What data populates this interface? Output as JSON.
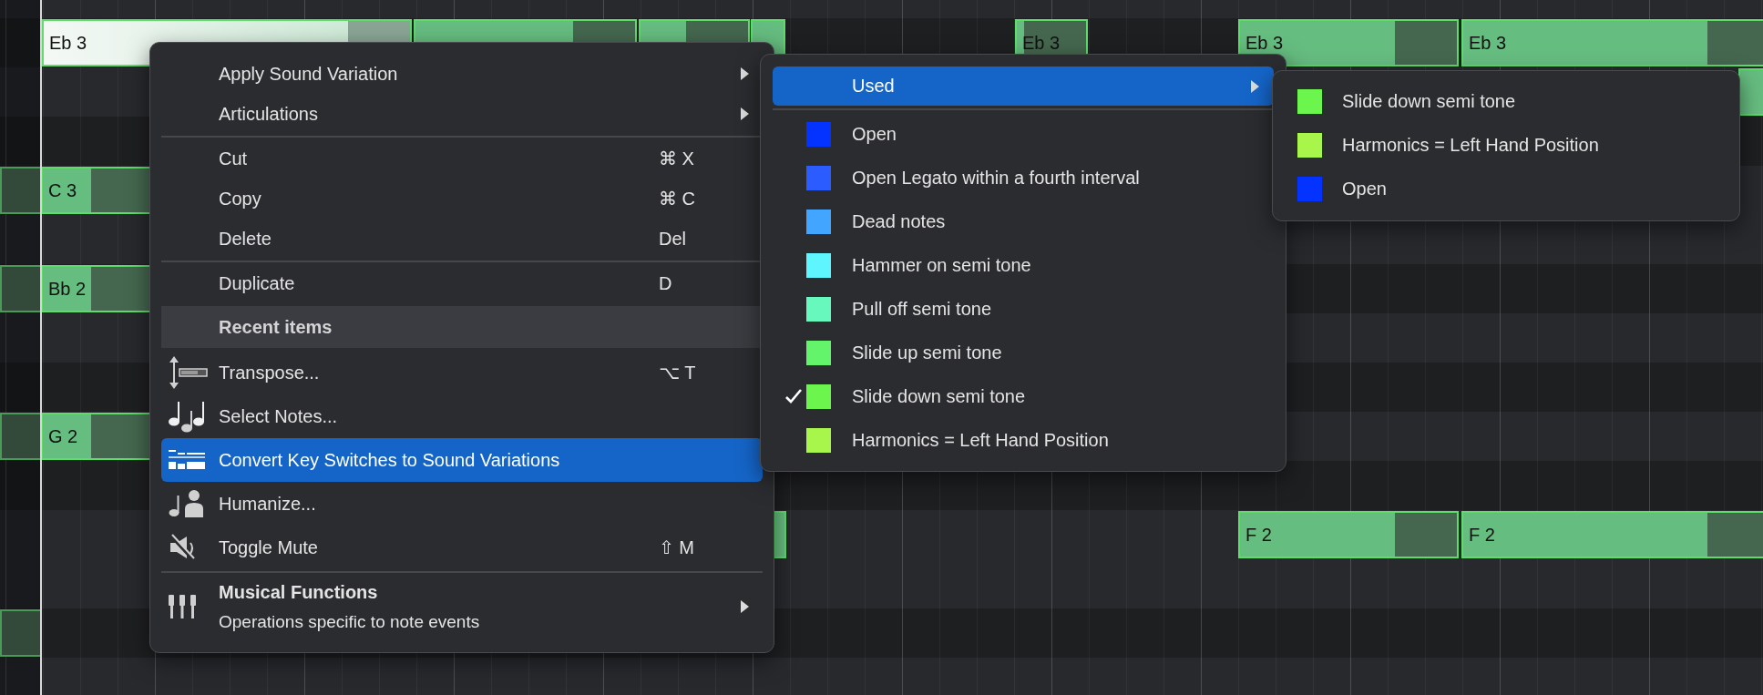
{
  "piano_roll": {
    "notes": [
      {
        "label": "Eb 3",
        "selected": true
      },
      {
        "selected": false
      },
      {
        "selected": false
      },
      {
        "selected": false
      },
      {
        "label": "Eb 3",
        "selected": false
      },
      {
        "label": "Eb 3",
        "selected": false
      },
      {
        "label": "Eb 3",
        "selected": false
      },
      {
        "selected": false
      },
      {
        "selected": false
      },
      {
        "label": "C 3",
        "selected": false
      },
      {
        "selected": false
      },
      {
        "label": "Bb 2",
        "selected": false
      },
      {
        "selected": false
      },
      {
        "label": "G 2",
        "selected": false
      },
      {
        "selected": false
      },
      {
        "label": "F 2",
        "selected": false
      },
      {
        "label": "F 2",
        "selected": false
      },
      {
        "selected": false
      }
    ]
  },
  "context_menu": {
    "sections": [
      {
        "items": [
          {
            "kind": "item",
            "label": "Apply Sound Variation",
            "submenu": true,
            "selected": false
          },
          {
            "kind": "item",
            "label": "Articulations",
            "submenu": true,
            "selected": false
          }
        ]
      },
      {
        "items": [
          {
            "kind": "item",
            "label": "Cut",
            "shortcut": "⌘ X",
            "selected": false
          },
          {
            "kind": "item",
            "label": "Copy",
            "shortcut": "⌘ C",
            "selected": false
          },
          {
            "kind": "item",
            "label": "Delete",
            "shortcut": "Del",
            "selected": false
          }
        ]
      },
      {
        "items": [
          {
            "kind": "item",
            "label": "Duplicate",
            "shortcut": "D",
            "selected": false
          },
          {
            "kind": "header",
            "label": "Recent items"
          },
          {
            "kind": "item",
            "label": "Transpose...",
            "shortcut": "⌥ T",
            "selected": false
          },
          {
            "kind": "item",
            "label": "Select Notes...",
            "selected": false
          },
          {
            "kind": "item",
            "label": "Convert Key Switches to Sound Variations",
            "selected": true
          },
          {
            "kind": "item",
            "label": "Humanize...",
            "selected": false
          },
          {
            "kind": "item",
            "label": "Toggle Mute",
            "shortcut": "⇧ M",
            "selected": false
          }
        ]
      },
      {
        "items": [
          {
            "kind": "group",
            "label": "Musical Functions",
            "description": "Operations specific to note events",
            "submenu": true,
            "selected": false
          }
        ]
      }
    ]
  },
  "sound_variation_menu": {
    "header": {
      "label": "Used",
      "submenu": true,
      "selected": true
    },
    "items": [
      {
        "label": "Open",
        "color": "#0433ff",
        "checked": false
      },
      {
        "label": "Open Legato within a fourth interval",
        "color": "#2a5cff",
        "checked": false
      },
      {
        "label": "Dead notes",
        "color": "#42a5ff",
        "checked": false
      },
      {
        "label": "Hammer on semi tone",
        "color": "#5ff5ff",
        "checked": false
      },
      {
        "label": "Pull off semi tone",
        "color": "#66f8bc",
        "checked": false
      },
      {
        "label": "Slide up semi tone",
        "color": "#63f46c",
        "checked": false
      },
      {
        "label": "Slide down semi tone",
        "color": "#6cf54c",
        "checked": true
      },
      {
        "label": "Harmonics = Left Hand Position",
        "color": "#a8f54c",
        "checked": false
      }
    ]
  },
  "used_menu": {
    "items": [
      {
        "label": "Slide down semi tone",
        "color": "#6cf54c"
      },
      {
        "label": "Harmonics = Left Hand Position",
        "color": "#a8f54c"
      },
      {
        "label": "Open",
        "color": "#0433ff"
      }
    ]
  }
}
